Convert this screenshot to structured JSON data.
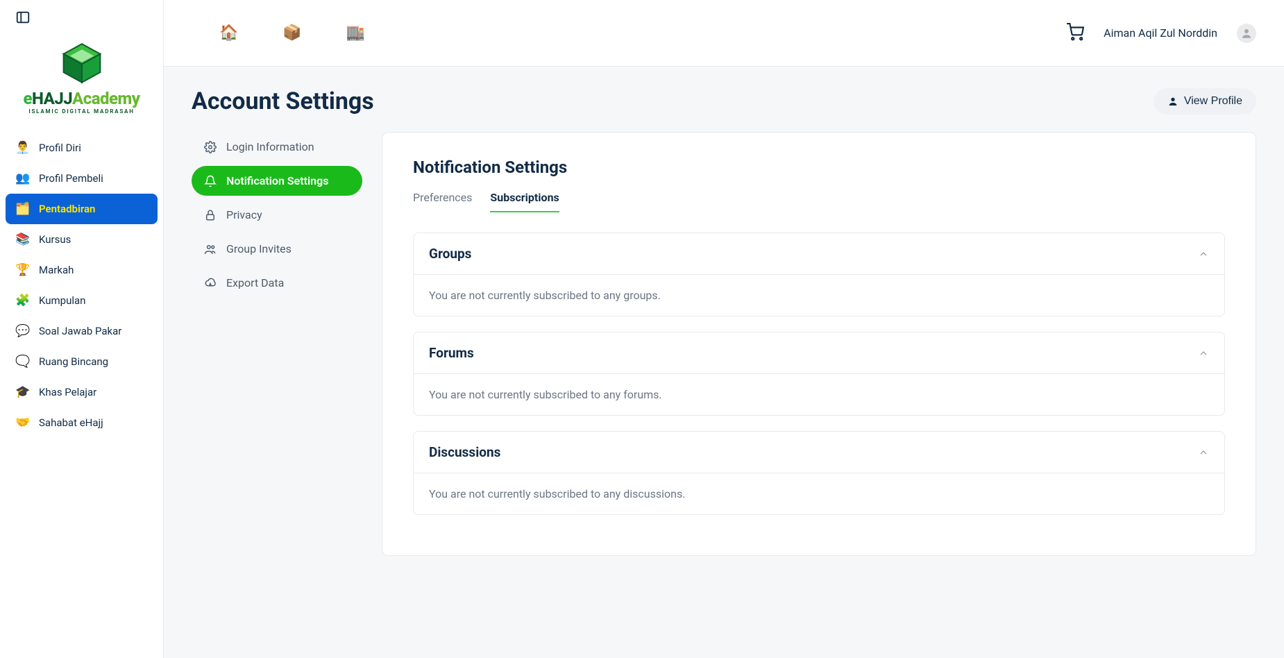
{
  "logo": {
    "brand_e": "e",
    "brand_hajj": "HAJJ",
    "brand_acad": "Academy",
    "sub": "ISLAMIC DIGITAL MADRASAH"
  },
  "sidebar": {
    "items": [
      {
        "emoji": "👨‍💼",
        "label": "Profil Diri"
      },
      {
        "emoji": "👥",
        "label": "Profil Pembeli"
      },
      {
        "emoji": "🗂️",
        "label": "Pentadbiran"
      },
      {
        "emoji": "📚",
        "label": "Kursus"
      },
      {
        "emoji": "🏆",
        "label": "Markah"
      },
      {
        "emoji": "🧩",
        "label": "Kumpulan"
      },
      {
        "emoji": "💬",
        "label": "Soal Jawab Pakar"
      },
      {
        "emoji": "🗨️",
        "label": "Ruang Bincang"
      },
      {
        "emoji": "🎓",
        "label": "Khas Pelajar"
      },
      {
        "emoji": "🤝",
        "label": "Sahabat eHajj"
      }
    ]
  },
  "topbar": {
    "icons": [
      "🏠",
      "📦",
      "🏬"
    ],
    "username": "Aiman Aqil Zul Norddin"
  },
  "page": {
    "title": "Account Settings",
    "view_profile": "View Profile"
  },
  "settings_nav": [
    {
      "label": "Login Information"
    },
    {
      "label": "Notification Settings"
    },
    {
      "label": "Privacy"
    },
    {
      "label": "Group Invites"
    },
    {
      "label": "Export Data"
    }
  ],
  "panel": {
    "title": "Notification Settings",
    "tabs": {
      "preferences": "Preferences",
      "subscriptions": "Subscriptions"
    },
    "sections": [
      {
        "title": "Groups",
        "body": "You are not currently subscribed to any groups."
      },
      {
        "title": "Forums",
        "body": "You are not currently subscribed to any forums."
      },
      {
        "title": "Discussions",
        "body": "You are not currently subscribed to any discussions."
      }
    ]
  }
}
